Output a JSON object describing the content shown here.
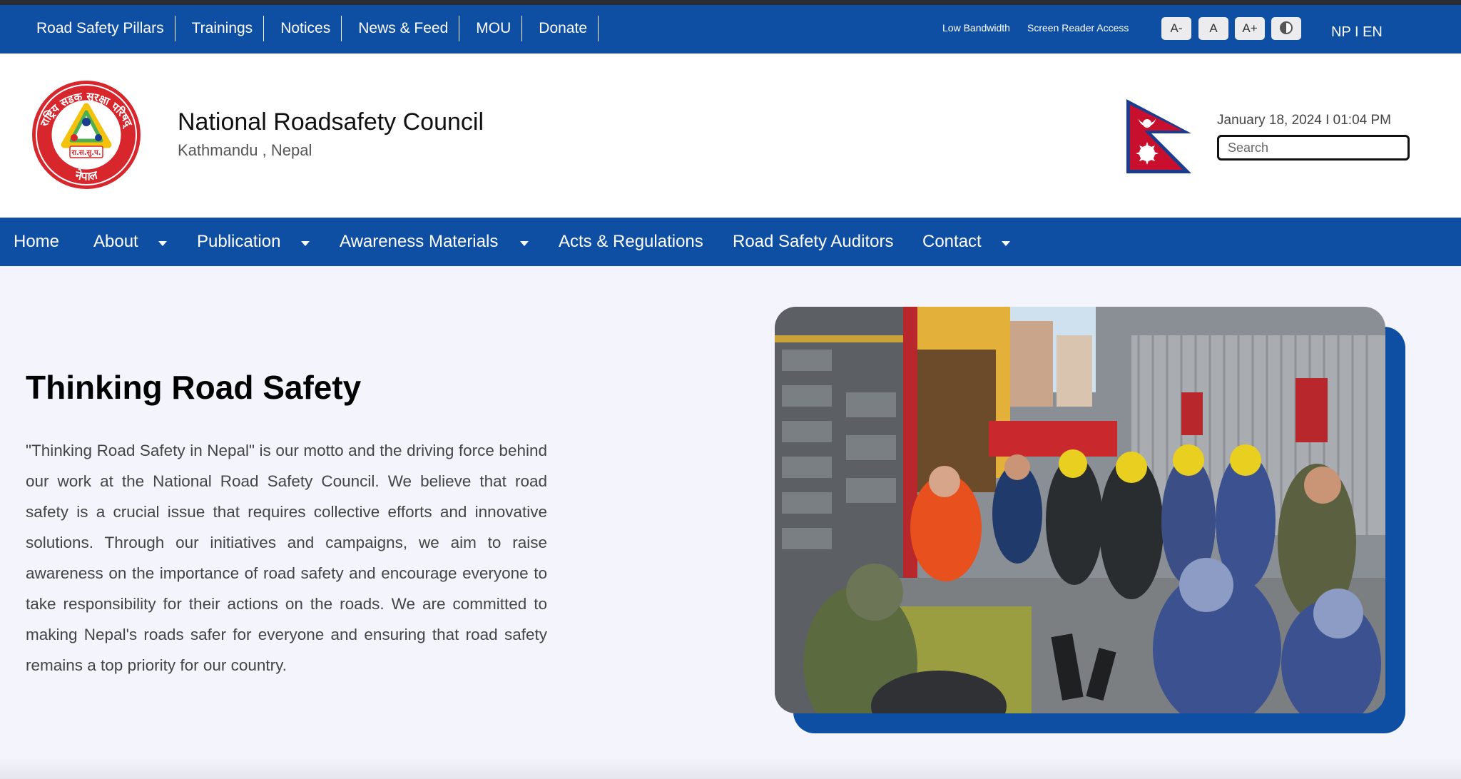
{
  "topbar": {
    "links": [
      "Road Safety Pillars",
      "Trainings",
      "Notices",
      "News & Feed",
      "MOU",
      "Donate"
    ],
    "low_bandwidth": "Low Bandwidth",
    "screen_reader": "Screen Reader Access",
    "font_decrease": "A-",
    "font_reset": "A",
    "font_increase": "A+",
    "language": "NP I EN"
  },
  "header": {
    "org_name": "National Roadsafety Council",
    "location": "Kathmandu , Nepal",
    "datetime": "January 18, 2024 I 01:04 PM",
    "search_placeholder": "Search",
    "logo": {
      "ring_text": "राष्ट्रिय सडक सुरक्षा परिषद्",
      "bottom_text": "नेपाल",
      "abbr": "रा.स.सु.प."
    }
  },
  "nav": {
    "home": "Home",
    "about": "About",
    "publication": "Publication",
    "awareness": "Awareness Materials",
    "acts": "Acts & Regulations",
    "auditors": "Road Safety Auditors",
    "contact": "Contact"
  },
  "hero": {
    "title": "Thinking Road Safety",
    "body": "\"Thinking Road Safety in Nepal\" is our motto and the driving force behind our work at the National Road Safety Council. We believe that road safety is a crucial issue that requires collective efforts and innovative solutions. Through our initiatives and campaigns, we aim to raise awareness on the importance of road safety and encourage everyone to take responsibility for their actions on the roads. We are committed to making Nepal's roads safer for everyone and ensuring that road safety remains a top priority for our country."
  },
  "colors": {
    "brand_blue": "#0f4fa3",
    "logo_red": "#d7262c",
    "flag_red": "#c8102e",
    "flag_border": "#1a3d8f",
    "page_bg": "#f4f4fc"
  },
  "icons": {
    "contrast": "contrast-icon",
    "dropdown": "chevron-down-icon"
  }
}
